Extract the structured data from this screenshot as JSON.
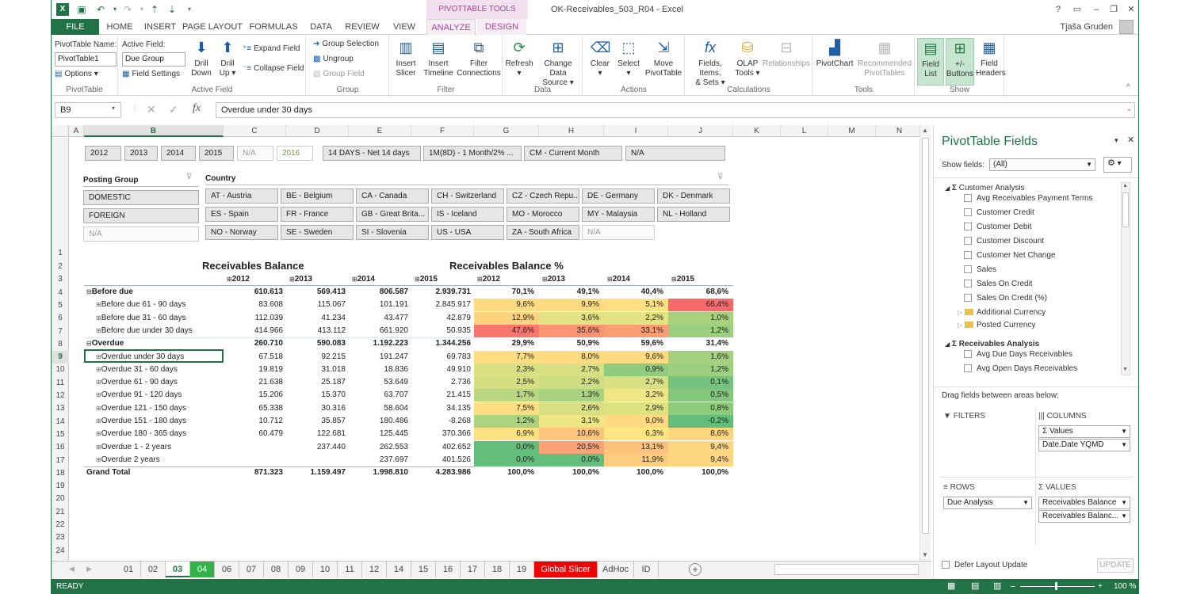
{
  "window": {
    "title": "OK-Receivables_503_R04 - Excel",
    "context_tab_group": "PIVOTTABLE TOOLS",
    "user": "Tjaša Gruden"
  },
  "tabs": [
    "FILE",
    "HOME",
    "INSERT",
    "PAGE LAYOUT",
    "FORMULAS",
    "DATA",
    "REVIEW",
    "VIEW",
    "ANALYZE",
    "DESIGN"
  ],
  "ribbon": {
    "pivottable": {
      "name_label": "PivotTable Name:",
      "name_value": "PivotTable1",
      "options": "Options",
      "group": "PivotTable"
    },
    "active_field": {
      "label": "Active Field:",
      "value": "Due Group",
      "settings": "Field Settings",
      "drill_down_1": "Drill",
      "drill_down_2": "Down",
      "drill_up_1": "Drill",
      "drill_up_2": "Up",
      "expand": "Expand Field",
      "collapse": "Collapse Field",
      "group": "Active Field"
    },
    "group": {
      "selection": "Group Selection",
      "ungroup": "Ungroup",
      "field": "Group Field",
      "group": "Group"
    },
    "filter": {
      "slicer_1": "Insert",
      "slicer_2": "Slicer",
      "timeline_1": "Insert",
      "timeline_2": "Timeline",
      "conn_1": "Filter",
      "conn_2": "Connections",
      "group": "Filter"
    },
    "data": {
      "refresh": "Refresh",
      "change_1": "Change Data",
      "change_2": "Source",
      "group": "Data"
    },
    "actions": {
      "clear": "Clear",
      "select": "Select",
      "move_1": "Move",
      "move_2": "PivotTable",
      "group": "Actions"
    },
    "calc": {
      "fields_1": "Fields, Items,",
      "fields_2": "& Sets",
      "olap_1": "OLAP",
      "olap_2": "Tools",
      "relationships": "Relationships",
      "group": "Calculations"
    },
    "tools": {
      "pivotchart": "PivotChart",
      "recommended_1": "Recommended",
      "recommended_2": "PivotTables",
      "group": "Tools"
    },
    "show": {
      "fieldlist_1": "Field",
      "fieldlist_2": "List",
      "buttons_1": "+/-",
      "buttons_2": "Buttons",
      "headers_1": "Field",
      "headers_2": "Headers",
      "group": "Show"
    }
  },
  "formula_bar": {
    "name_box": "B9",
    "formula": "Overdue under 30 days"
  },
  "columns": [
    "A",
    "B",
    "C",
    "D",
    "E",
    "F",
    "G",
    "H",
    "I",
    "J",
    "K",
    "L",
    "M",
    "N"
  ],
  "rows": [
    "1",
    "2",
    "3",
    "4",
    "5",
    "6",
    "7",
    "8",
    "9",
    "10",
    "11",
    "12",
    "13",
    "14",
    "15",
    "16",
    "17",
    "18",
    "19",
    "20",
    "21",
    "22",
    "23",
    "24"
  ],
  "slicers": {
    "years": [
      "2012",
      "2013",
      "2014",
      "2015",
      "N/A",
      "2016"
    ],
    "terms": [
      "14 DAYS - Net 14 days",
      "1M(8D) - 1 Month/2% ...",
      "CM - Current Month",
      "N/A"
    ],
    "posting_group_title": "Posting Group",
    "posting_groups": [
      "DOMESTIC",
      "FOREIGN",
      "N/A"
    ],
    "country_title": "Country",
    "countries": [
      "AT - Austria",
      "BE - Belgium",
      "CA - Canada",
      "CH - Switzerland",
      "CZ - Czech Repu...",
      "DE - Germany",
      "DK - Denmark",
      "ES - Spain",
      "FR - France",
      "GB - Great Brita...",
      "IS - Iceland",
      "MO - Morocco",
      "MY - Malaysia",
      "NL - Holland",
      "NO - Norway",
      "SE - Sweden",
      "SI - Slovenia",
      "US - USA",
      "ZA - South Africa",
      "N/A"
    ]
  },
  "pivot": {
    "header_balance": "Receivables Balance",
    "header_pct": "Receivables Balance %",
    "years": [
      "2012",
      "2013",
      "2014",
      "2015"
    ],
    "rows": [
      {
        "label": "Before due",
        "level": 0,
        "bold": true,
        "v": [
          "610.613",
          "569.413",
          "806.587",
          "2.939.731"
        ],
        "p": [
          "70,1%",
          "49,1%",
          "40,4%",
          "68,6%"
        ]
      },
      {
        "label": "Before due 61 - 90 days",
        "level": 1,
        "v": [
          "83.608",
          "115.067",
          "101.191",
          "2.845.917"
        ],
        "p": [
          "9,6%",
          "9,9%",
          "5,1%",
          "66,4%"
        ]
      },
      {
        "label": "Before due 31 - 60 days",
        "level": 1,
        "v": [
          "112.039",
          "41.234",
          "43.477",
          "42.879"
        ],
        "p": [
          "12,9%",
          "3,6%",
          "2,2%",
          "1,0%"
        ]
      },
      {
        "label": "Before due under 30 days",
        "level": 1,
        "v": [
          "414.966",
          "413.112",
          "661.920",
          "50.935"
        ],
        "p": [
          "47,6%",
          "35,6%",
          "33,1%",
          "1,2%"
        ]
      },
      {
        "label": "Overdue",
        "level": 0,
        "bold": true,
        "v": [
          "260.710",
          "590.083",
          "1.192.223",
          "1.344.256"
        ],
        "p": [
          "29,9%",
          "50,9%",
          "59,6%",
          "31,4%"
        ]
      },
      {
        "label": "Overdue under 30 days",
        "level": 1,
        "v": [
          "67.518",
          "92.215",
          "191.247",
          "69.783"
        ],
        "p": [
          "7,7%",
          "8,0%",
          "9,6%",
          "1,6%"
        ]
      },
      {
        "label": "Overdue 31 - 60 days",
        "level": 1,
        "v": [
          "19.819",
          "31.018",
          "18.836",
          "49.910"
        ],
        "p": [
          "2,3%",
          "2,7%",
          "0,9%",
          "1,2%"
        ]
      },
      {
        "label": "Overdue 61 - 90 days",
        "level": 1,
        "v": [
          "21.638",
          "25.187",
          "53.649",
          "2.736"
        ],
        "p": [
          "2,5%",
          "2,2%",
          "2,7%",
          "0,1%"
        ]
      },
      {
        "label": "Overdue 91 - 120 days",
        "level": 1,
        "v": [
          "15.206",
          "15.370",
          "63.707",
          "21.415"
        ],
        "p": [
          "1,7%",
          "1,3%",
          "3,2%",
          "0,5%"
        ]
      },
      {
        "label": "Overdue 121 - 150 days",
        "level": 1,
        "v": [
          "65.338",
          "30.316",
          "58.604",
          "34.135"
        ],
        "p": [
          "7,5%",
          "2,6%",
          "2,9%",
          "0,8%"
        ]
      },
      {
        "label": "Overdue 151 - 180 days",
        "level": 1,
        "v": [
          "10.712",
          "35.857",
          "180.486",
          "-8.268"
        ],
        "p": [
          "1,2%",
          "3,1%",
          "9,0%",
          "-0,2%"
        ]
      },
      {
        "label": "Overdue 180 - 365 days",
        "level": 1,
        "v": [
          "60.479",
          "122.681",
          "125.445",
          "370.366"
        ],
        "p": [
          "6,9%",
          "10,6%",
          "6,3%",
          "8,6%"
        ]
      },
      {
        "label": "Overdue 1 - 2 years",
        "level": 1,
        "v": [
          "",
          "237.440",
          "262.553",
          "402.652"
        ],
        "p": [
          "0,0%",
          "20,5%",
          "13,1%",
          "9,4%"
        ]
      },
      {
        "label": "Overdue 2 years",
        "level": 1,
        "v": [
          "",
          "",
          "237.697",
          "401.526"
        ],
        "p": [
          "0,0%",
          "0,0%",
          "11,9%",
          "9,4%"
        ]
      },
      {
        "label": "Grand Total",
        "level": 0,
        "bold": true,
        "grand": true,
        "v": [
          "871.323",
          "1.159.497",
          "1.998.810",
          "4.283.986"
        ],
        "p": [
          "100,0%",
          "100,0%",
          "100,0%",
          "100,0%"
        ]
      }
    ],
    "pct_colors": [
      [
        "#ffffff",
        "#ffffff",
        "#ffffff",
        "#ffffff"
      ],
      [
        "#fedb81",
        "#fedb81",
        "#fedf82",
        "#f8696b"
      ],
      [
        "#fdd37f",
        "#e3e383",
        "#e2e383",
        "#a7d17f"
      ],
      [
        "#f8766d",
        "#fa9473",
        "#fb9e75",
        "#9bce7e"
      ],
      [
        "#ffffff",
        "#ffffff",
        "#ffffff",
        "#ffffff"
      ],
      [
        "#fedc81",
        "#fedb81",
        "#fedb81",
        "#a5d07f"
      ],
      [
        "#d9e082",
        "#d9e082",
        "#8fcb7d",
        "#9ccf7e"
      ],
      [
        "#d5df82",
        "#cdde82",
        "#d9e082",
        "#75c37c"
      ],
      [
        "#b9d780",
        "#a8d27f",
        "#efe684",
        "#82c77c"
      ],
      [
        "#fede81",
        "#d7df82",
        "#dde182",
        "#8fcb7d"
      ],
      [
        "#acd37f",
        "#ede684",
        "#feda81",
        "#63be7b"
      ],
      [
        "#fee182",
        "#fdc67c",
        "#fee783",
        "#fed580"
      ],
      [
        "#63be7b",
        "#fba276",
        "#fdc27c",
        "#fed580"
      ],
      [
        "#63be7b",
        "#63be7b",
        "#fdcd7e",
        "#fed580"
      ],
      [
        "#ffffff",
        "#ffffff",
        "#ffffff",
        "#ffffff"
      ]
    ]
  },
  "sheet_tabs": [
    "01",
    "02",
    "03",
    "04",
    "06",
    "07",
    "08",
    "09",
    "10",
    "11",
    "12",
    "14",
    "15",
    "16",
    "17",
    "18",
    "19",
    "Global Slicer",
    "AdHoc",
    "ID"
  ],
  "status": {
    "ready": "READY",
    "zoom": "100 %"
  },
  "pane": {
    "title": "PivotTable Fields",
    "show_fields_label": "Show fields:",
    "show_fields_value": "(All)",
    "customer_analysis": "Customer Analysis",
    "customer_fields": [
      "Avg Receivables Payment Terms",
      "Customer Credit",
      "Customer Debit",
      "Customer Discount",
      "Customer Net Change",
      "Sales",
      "Sales On Credit",
      "Sales On Credit (%)"
    ],
    "folders": [
      "Additional Currency",
      "Posted Currency"
    ],
    "receivables_analysis": "Receivables Analysis",
    "receivables_fields": [
      "Avg Due Days Receivables",
      "Avg Open Days Receivables"
    ],
    "drag_label": "Drag fields between areas below:",
    "filters": "FILTERS",
    "columns": "COLUMNS",
    "rows": "ROWS",
    "values": "VALUES",
    "column_items": [
      "Values",
      "Date.Date YQMD"
    ],
    "row_items": [
      "Due Analysis"
    ],
    "value_items": [
      "Receivables Balance",
      "Receivables Balanc..."
    ],
    "defer": "Defer Layout Update",
    "update": "UPDATE"
  }
}
